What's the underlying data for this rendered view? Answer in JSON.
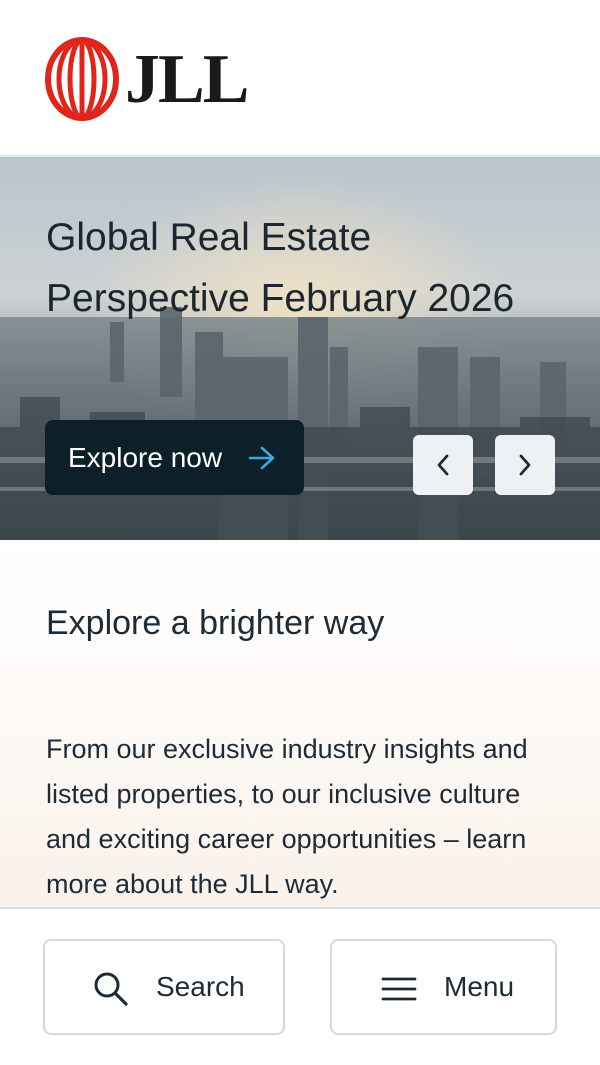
{
  "header": {
    "logo_text": "JLL",
    "brand_color": "#e1251b"
  },
  "hero": {
    "title": "Global Real Estate Perspective February 2026",
    "cta_label": "Explore now",
    "cta_icon": "arrow-right-icon",
    "prev_icon": "chevron-left-icon",
    "next_icon": "chevron-right-icon",
    "cta_background": "#0d1f28",
    "cta_arrow_color": "#39a9dc"
  },
  "intro": {
    "heading": "Explore a brighter way",
    "body": "From our exclusive industry insights and listed properties, to our inclusive culture and exciting career opportunities – learn more about the JLL way."
  },
  "bottom_bar": {
    "search_label": "Search",
    "search_icon": "search-icon",
    "menu_label": "Menu",
    "menu_icon": "hamburger-menu-icon"
  }
}
